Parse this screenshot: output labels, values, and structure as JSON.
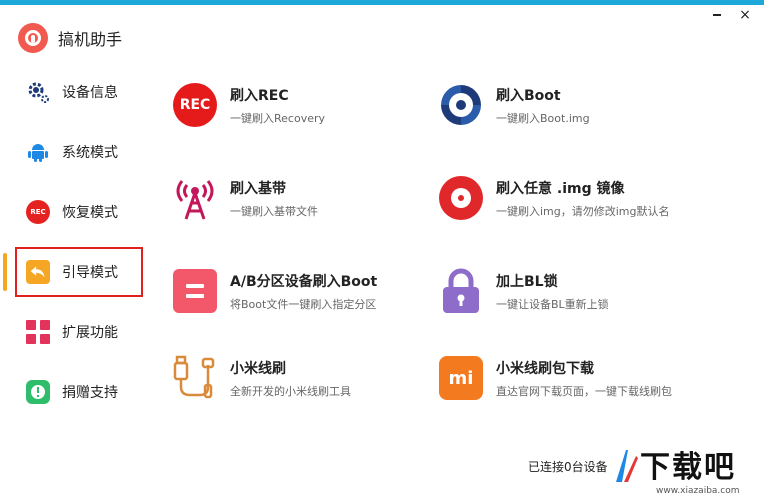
{
  "app": {
    "title": "搞机助手",
    "close_glyph": "×"
  },
  "sidebar": {
    "items": [
      {
        "label": "设备信息",
        "icon": "gear-icon"
      },
      {
        "label": "系统模式",
        "icon": "android-icon"
      },
      {
        "label": "恢复模式",
        "icon": "rec-icon",
        "icon_text": "REC"
      },
      {
        "label": "引导模式",
        "icon": "back-arrow-icon",
        "active": true
      },
      {
        "label": "扩展功能",
        "icon": "grid-icon"
      },
      {
        "label": "捐赠支持",
        "icon": "donate-icon"
      }
    ]
  },
  "main": {
    "cards": [
      {
        "title": "刷入REC",
        "subtitle": "一键刷入Recovery",
        "icon": "rec-icon",
        "icon_text": "REC"
      },
      {
        "title": "刷入Boot",
        "subtitle": "一键刷入Boot.img",
        "icon": "boot-icon"
      },
      {
        "title": "刷入基带",
        "subtitle": "一键刷入基带文件",
        "icon": "antenna-icon"
      },
      {
        "title": "刷入任意 .img 镜像",
        "subtitle": "一键刷入img，请勿修改img默认名",
        "icon": "disc-icon"
      },
      {
        "title": "A/B分区设备刷入Boot",
        "subtitle": "将Boot文件一键刷入指定分区",
        "icon": "ab-partition-icon"
      },
      {
        "title": "加上BL锁",
        "subtitle": "一键让设备BL重新上锁",
        "icon": "lock-icon"
      },
      {
        "title": "小米线刷",
        "subtitle": "全新开发的小米线刷工具",
        "icon": "usb-cable-icon"
      },
      {
        "title": "小米线刷包下载",
        "subtitle": "直达官网下载页面，一键下载线刷包",
        "icon": "mi-logo-icon",
        "icon_text": "mi"
      }
    ]
  },
  "status": {
    "text": "已连接0台设备"
  },
  "watermark": {
    "text": "下载吧",
    "url": "www.xiazaiba.com"
  },
  "colors": {
    "accent_bar": "#1ea7d9",
    "active_indicator": "#f5a623",
    "active_outline": "#e02020",
    "rec_red": "#e51b1b",
    "boot_blue": "#1e3a78",
    "antenna_magenta": "#c2185b",
    "ab_pink": "#f2576a",
    "lock_purple": "#8e6cc9",
    "mi_orange": "#f47a20",
    "cable_orange": "#d98a3a"
  }
}
